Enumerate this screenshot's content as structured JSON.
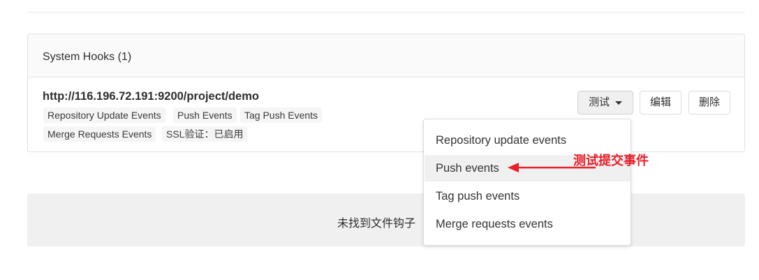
{
  "system_hooks": {
    "title": "System Hooks (1)",
    "hook": {
      "url": "http://116.196.72.191:9200/project/demo",
      "badges_row1": [
        "Repository Update Events",
        "Push Events",
        "Tag Push Events"
      ],
      "badges_row2": [
        "Merge Requests Events",
        "SSL验证：已启用"
      ]
    },
    "actions": {
      "test_label": "测试",
      "edit_label": "编辑",
      "delete_label": "删除"
    }
  },
  "test_dropdown": {
    "items": [
      "Repository update events",
      "Push events",
      "Tag push events",
      "Merge requests events"
    ],
    "highlighted": "Push events"
  },
  "file_hooks_empty": {
    "message": "未找到文件钩子"
  },
  "annotation": {
    "text": "测试提交事件",
    "color": "#e8202a"
  }
}
